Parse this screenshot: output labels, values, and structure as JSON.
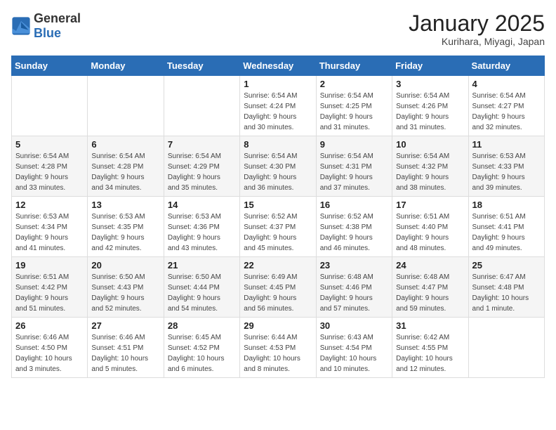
{
  "header": {
    "logo_general": "General",
    "logo_blue": "Blue",
    "month_title": "January 2025",
    "location": "Kurihara, Miyagi, Japan"
  },
  "weekdays": [
    "Sunday",
    "Monday",
    "Tuesday",
    "Wednesday",
    "Thursday",
    "Friday",
    "Saturday"
  ],
  "weeks": [
    [
      {
        "day": "",
        "info": ""
      },
      {
        "day": "",
        "info": ""
      },
      {
        "day": "",
        "info": ""
      },
      {
        "day": "1",
        "info": "Sunrise: 6:54 AM\nSunset: 4:24 PM\nDaylight: 9 hours\nand 30 minutes."
      },
      {
        "day": "2",
        "info": "Sunrise: 6:54 AM\nSunset: 4:25 PM\nDaylight: 9 hours\nand 31 minutes."
      },
      {
        "day": "3",
        "info": "Sunrise: 6:54 AM\nSunset: 4:26 PM\nDaylight: 9 hours\nand 31 minutes."
      },
      {
        "day": "4",
        "info": "Sunrise: 6:54 AM\nSunset: 4:27 PM\nDaylight: 9 hours\nand 32 minutes."
      }
    ],
    [
      {
        "day": "5",
        "info": "Sunrise: 6:54 AM\nSunset: 4:28 PM\nDaylight: 9 hours\nand 33 minutes."
      },
      {
        "day": "6",
        "info": "Sunrise: 6:54 AM\nSunset: 4:28 PM\nDaylight: 9 hours\nand 34 minutes."
      },
      {
        "day": "7",
        "info": "Sunrise: 6:54 AM\nSunset: 4:29 PM\nDaylight: 9 hours\nand 35 minutes."
      },
      {
        "day": "8",
        "info": "Sunrise: 6:54 AM\nSunset: 4:30 PM\nDaylight: 9 hours\nand 36 minutes."
      },
      {
        "day": "9",
        "info": "Sunrise: 6:54 AM\nSunset: 4:31 PM\nDaylight: 9 hours\nand 37 minutes."
      },
      {
        "day": "10",
        "info": "Sunrise: 6:54 AM\nSunset: 4:32 PM\nDaylight: 9 hours\nand 38 minutes."
      },
      {
        "day": "11",
        "info": "Sunrise: 6:53 AM\nSunset: 4:33 PM\nDaylight: 9 hours\nand 39 minutes."
      }
    ],
    [
      {
        "day": "12",
        "info": "Sunrise: 6:53 AM\nSunset: 4:34 PM\nDaylight: 9 hours\nand 41 minutes."
      },
      {
        "day": "13",
        "info": "Sunrise: 6:53 AM\nSunset: 4:35 PM\nDaylight: 9 hours\nand 42 minutes."
      },
      {
        "day": "14",
        "info": "Sunrise: 6:53 AM\nSunset: 4:36 PM\nDaylight: 9 hours\nand 43 minutes."
      },
      {
        "day": "15",
        "info": "Sunrise: 6:52 AM\nSunset: 4:37 PM\nDaylight: 9 hours\nand 45 minutes."
      },
      {
        "day": "16",
        "info": "Sunrise: 6:52 AM\nSunset: 4:38 PM\nDaylight: 9 hours\nand 46 minutes."
      },
      {
        "day": "17",
        "info": "Sunrise: 6:51 AM\nSunset: 4:40 PM\nDaylight: 9 hours\nand 48 minutes."
      },
      {
        "day": "18",
        "info": "Sunrise: 6:51 AM\nSunset: 4:41 PM\nDaylight: 9 hours\nand 49 minutes."
      }
    ],
    [
      {
        "day": "19",
        "info": "Sunrise: 6:51 AM\nSunset: 4:42 PM\nDaylight: 9 hours\nand 51 minutes."
      },
      {
        "day": "20",
        "info": "Sunrise: 6:50 AM\nSunset: 4:43 PM\nDaylight: 9 hours\nand 52 minutes."
      },
      {
        "day": "21",
        "info": "Sunrise: 6:50 AM\nSunset: 4:44 PM\nDaylight: 9 hours\nand 54 minutes."
      },
      {
        "day": "22",
        "info": "Sunrise: 6:49 AM\nSunset: 4:45 PM\nDaylight: 9 hours\nand 56 minutes."
      },
      {
        "day": "23",
        "info": "Sunrise: 6:48 AM\nSunset: 4:46 PM\nDaylight: 9 hours\nand 57 minutes."
      },
      {
        "day": "24",
        "info": "Sunrise: 6:48 AM\nSunset: 4:47 PM\nDaylight: 9 hours\nand 59 minutes."
      },
      {
        "day": "25",
        "info": "Sunrise: 6:47 AM\nSunset: 4:48 PM\nDaylight: 10 hours\nand 1 minute."
      }
    ],
    [
      {
        "day": "26",
        "info": "Sunrise: 6:46 AM\nSunset: 4:50 PM\nDaylight: 10 hours\nand 3 minutes."
      },
      {
        "day": "27",
        "info": "Sunrise: 6:46 AM\nSunset: 4:51 PM\nDaylight: 10 hours\nand 5 minutes."
      },
      {
        "day": "28",
        "info": "Sunrise: 6:45 AM\nSunset: 4:52 PM\nDaylight: 10 hours\nand 6 minutes."
      },
      {
        "day": "29",
        "info": "Sunrise: 6:44 AM\nSunset: 4:53 PM\nDaylight: 10 hours\nand 8 minutes."
      },
      {
        "day": "30",
        "info": "Sunrise: 6:43 AM\nSunset: 4:54 PM\nDaylight: 10 hours\nand 10 minutes."
      },
      {
        "day": "31",
        "info": "Sunrise: 6:42 AM\nSunset: 4:55 PM\nDaylight: 10 hours\nand 12 minutes."
      },
      {
        "day": "",
        "info": ""
      }
    ]
  ]
}
